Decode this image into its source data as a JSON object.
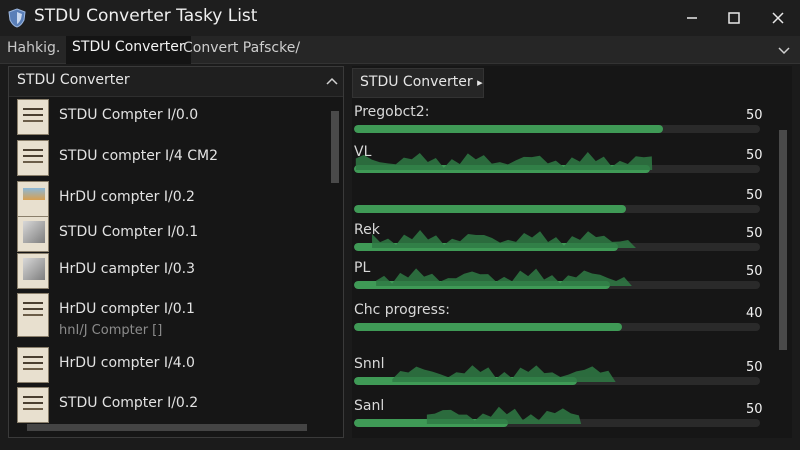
{
  "window": {
    "title": "STDU Converter Tasky List"
  },
  "tabs": [
    {
      "label": "Hahkig."
    },
    {
      "label": "STDU Converter"
    },
    {
      "label": "Convert Pafscke/"
    }
  ],
  "left_panel": {
    "title": "STDU Converter",
    "items": [
      {
        "label": "STDU Compter I/0.0"
      },
      {
        "label": "STDU compter I/4 CM2"
      },
      {
        "label": "HrDU compter I/0.2"
      },
      {
        "label": "STDU Compter I/0.1"
      },
      {
        "label": "HrDU campter I/0.3"
      },
      {
        "label": "HrDU compter I/0.1",
        "sub": "hnI/J Compter []"
      },
      {
        "label": "HrDU compter I/4.0"
      },
      {
        "label": "STDU Compter I/0.2"
      }
    ]
  },
  "right_panel": {
    "title": "STDU Converter",
    "title_arrow": "▸",
    "rows": [
      {
        "label": "Pregobct2:",
        "value": "50",
        "progress": 0.76
      },
      {
        "label": "VL",
        "value": "50",
        "progress": 0.73
      },
      {
        "label": "",
        "value": "50",
        "progress": 0.67
      },
      {
        "label": "Rek",
        "value": "50",
        "progress": 0.65
      },
      {
        "label": "PL",
        "value": "50",
        "progress": 0.63
      },
      {
        "label": "Chc progress:",
        "value": "40",
        "progress": 0.66
      },
      {
        "label": "Snnl",
        "value": "50",
        "progress": 0.55
      },
      {
        "label": "Sanl",
        "value": "50",
        "progress": 0.38
      }
    ]
  },
  "icons": {
    "app": "shield-app-icon",
    "minimize": "minimize-icon",
    "maximize": "maximize-icon",
    "close": "close-icon",
    "chevron": "chevron-down-icon",
    "collapse": "chevron-up-icon"
  },
  "colors": {
    "accent": "#3f9a56",
    "background": "#1b1b1b"
  }
}
